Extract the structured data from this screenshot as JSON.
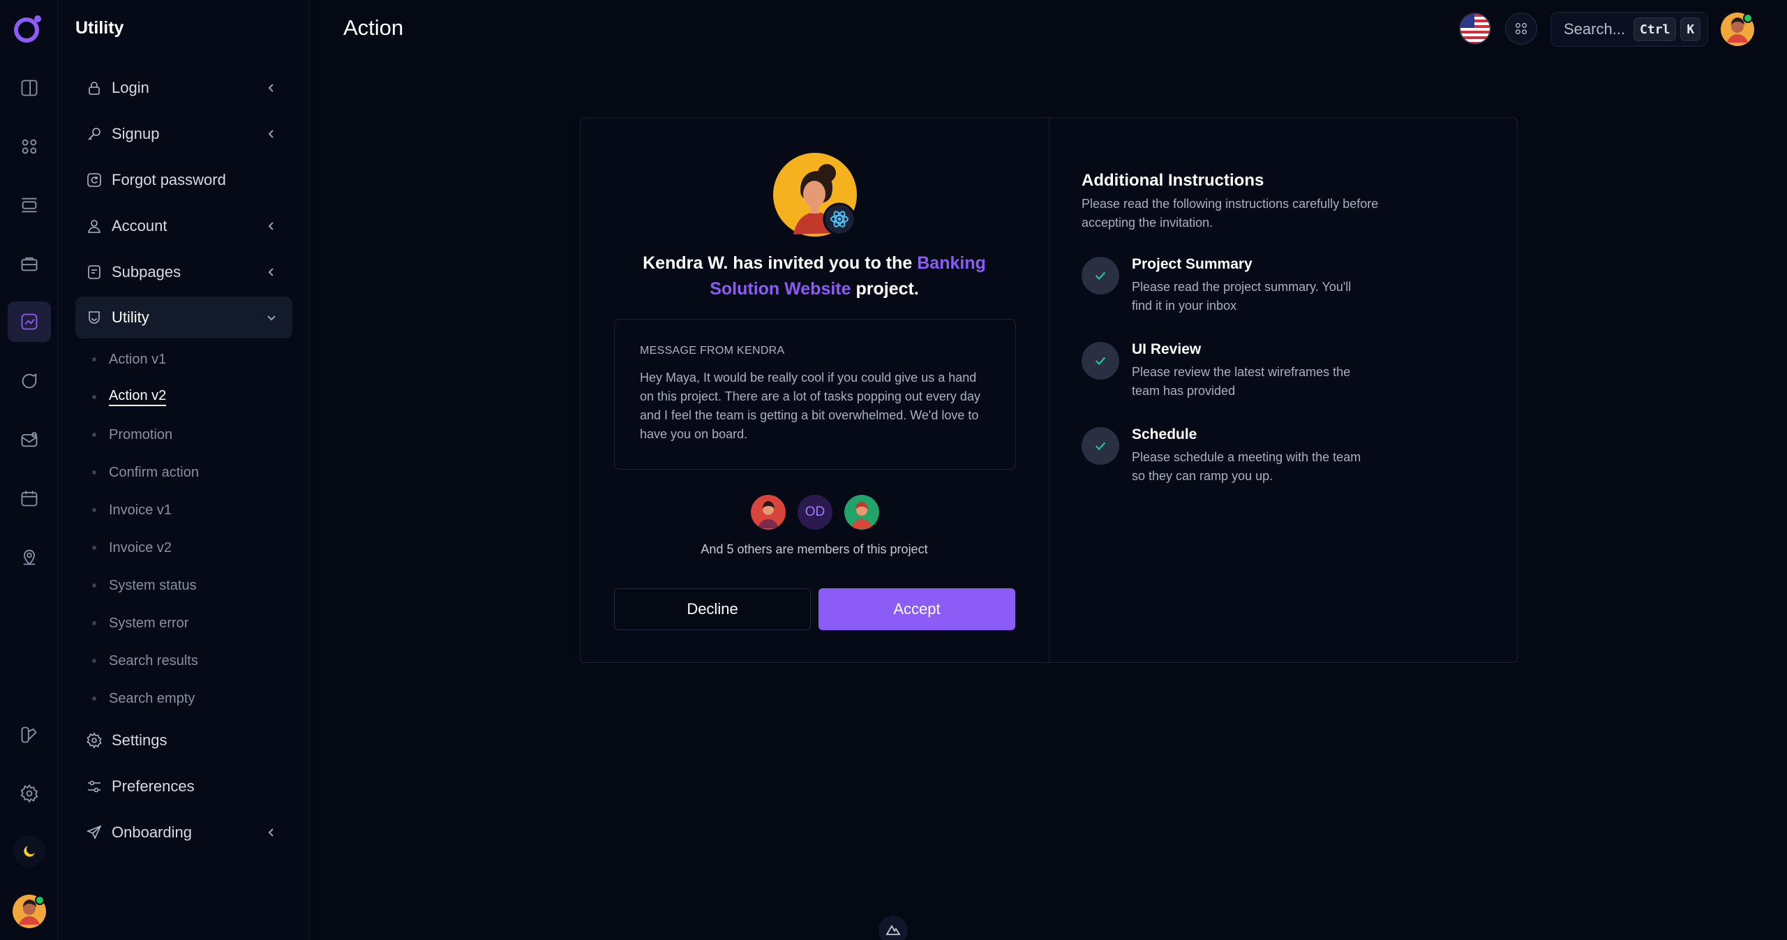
{
  "sidebar": {
    "title": "Utility",
    "items": [
      {
        "label": "Login"
      },
      {
        "label": "Signup"
      },
      {
        "label": "Forgot password"
      },
      {
        "label": "Account"
      },
      {
        "label": "Subpages"
      },
      {
        "label": "Utility"
      },
      {
        "label": "Settings"
      },
      {
        "label": "Preferences"
      },
      {
        "label": "Onboarding"
      }
    ],
    "utility_sub": [
      "Action v1",
      "Action v2",
      "Promotion",
      "Confirm action",
      "Invoice v1",
      "Invoice v2",
      "System status",
      "System error",
      "Search results",
      "Search empty"
    ]
  },
  "header": {
    "title": "Action",
    "search_placeholder": "Search...",
    "kbd_ctrl": "Ctrl",
    "kbd_k": "K"
  },
  "invite": {
    "inviter": "Kendra W.",
    "text_pre": "Kendra W. has invited you to the",
    "project_name": "Banking Solution Website",
    "text_post": "project.",
    "message_kicker": "Message from Kendra",
    "message_body": "Hey Maya, It would be really cool if you could give us a hand on this project. There are a lot of tasks popping out every day and I feel the team is getting a bit overwhelmed. We'd love to have you on board.",
    "member_initials": "OD",
    "members_note": "And 5 others are members of this project",
    "decline_label": "Decline",
    "accept_label": "Accept"
  },
  "instructions": {
    "title": "Additional Instructions",
    "subtitle": "Please read the following instructions carefully before accepting the invitation.",
    "steps": [
      {
        "title": "Project Summary",
        "desc": "Please read the project summary. You'll find it in your inbox"
      },
      {
        "title": "UI Review",
        "desc": "Please review the latest wireframes the team has provided"
      },
      {
        "title": "Schedule",
        "desc": "Please schedule a meeting with the team so they can ramp you up."
      }
    ]
  },
  "colors": {
    "accent": "#8b5cf6",
    "check": "#22c3a6",
    "background": "#050914"
  }
}
